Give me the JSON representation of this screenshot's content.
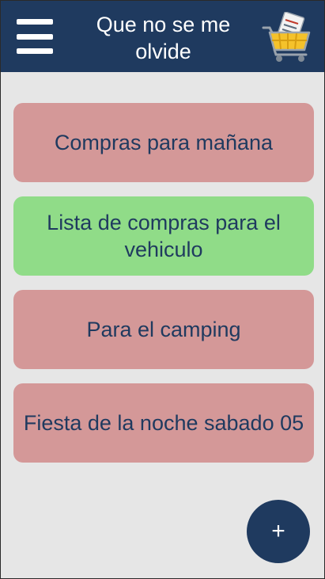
{
  "appbar": {
    "title": "Que no se me olvide",
    "menu_icon": "hamburger-menu-icon",
    "logo_icon": "shopping-cart-icon",
    "colors": {
      "background": "#1f3a5f",
      "text": "#ffffff"
    }
  },
  "lists": [
    {
      "label": "Compras para mañana",
      "color": "#d49898"
    },
    {
      "label": "Lista de compras para el vehiculo",
      "color": "#90dc88"
    },
    {
      "label": "Para el camping",
      "color": "#d49898"
    },
    {
      "label": "Fiesta de la noche sabado 05",
      "color": "#d49898"
    }
  ],
  "fab": {
    "label": "+",
    "color": "#1f3a5f"
  },
  "page": {
    "background": "#e6e6e6"
  }
}
